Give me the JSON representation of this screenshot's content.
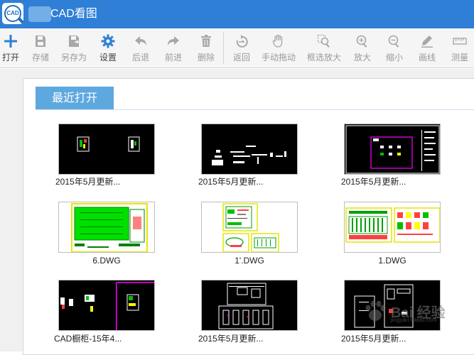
{
  "window": {
    "title": "CAD看图"
  },
  "toolbar": {
    "buttons": [
      {
        "label": "打开",
        "icon": "plus-icon",
        "active": true
      },
      {
        "label": "存储",
        "icon": "save-icon",
        "active": false
      },
      {
        "label": "另存为",
        "icon": "save-as-icon",
        "active": false
      },
      {
        "label": "设置",
        "icon": "gear-icon",
        "active": true
      },
      {
        "label": "后退",
        "icon": "undo-arrow-icon",
        "active": false
      },
      {
        "label": "前进",
        "icon": "redo-arrow-icon",
        "active": false
      },
      {
        "label": "删除",
        "icon": "trash-icon",
        "active": false
      },
      {
        "label": "返回",
        "icon": "rotate-back-icon",
        "active": false
      },
      {
        "label": "手动拖动",
        "icon": "hand-icon",
        "active": false
      },
      {
        "label": "框选放大",
        "icon": "box-zoom-icon",
        "active": false
      },
      {
        "label": "放大",
        "icon": "zoom-in-icon",
        "active": false
      },
      {
        "label": "缩小",
        "icon": "zoom-out-icon",
        "active": false
      },
      {
        "label": "画线",
        "icon": "pen-icon",
        "active": false
      },
      {
        "label": "测量",
        "icon": "ruler-icon",
        "active": false
      }
    ]
  },
  "recent": {
    "tab_label": "最近打开",
    "files": [
      {
        "name": "2015年5月更新...",
        "style": "dark"
      },
      {
        "name": "2015年5月更新...",
        "style": "dark"
      },
      {
        "name": "2015年5月更新...",
        "style": "dark"
      },
      {
        "name": "6.DWG",
        "style": "light"
      },
      {
        "name": "1'.DWG",
        "style": "light"
      },
      {
        "name": "1.DWG",
        "style": "light"
      },
      {
        "name": "CAD橱柜-15年4...",
        "style": "dark"
      },
      {
        "name": "2015年5月更新...",
        "style": "dark"
      },
      {
        "name": "2015年5月更新...",
        "style": "dark"
      }
    ]
  },
  "watermark": {
    "text": "Bai 经验",
    "sub": "jingyan.baidu.com"
  },
  "colors": {
    "titlebar": "#2f7fd6",
    "tab": "#5ea8e0",
    "toolbar_bg": "#f5f5f5"
  }
}
